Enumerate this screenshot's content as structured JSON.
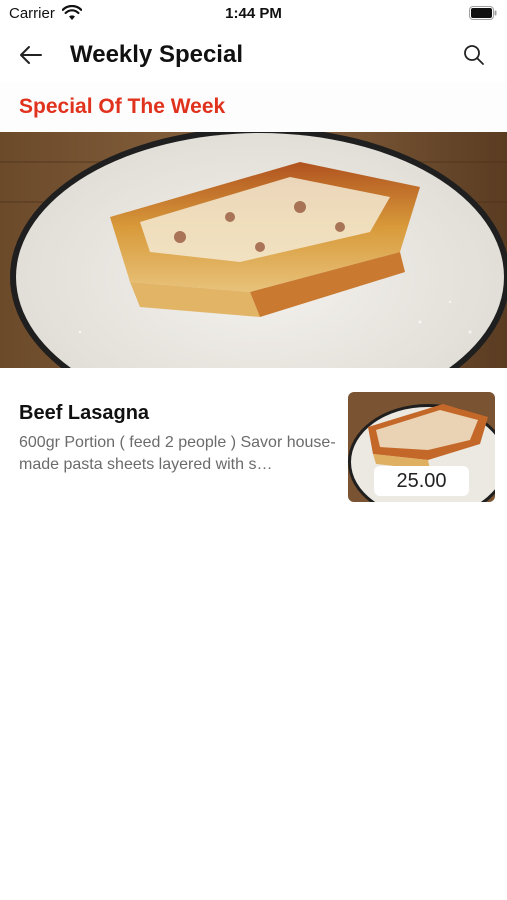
{
  "status_bar": {
    "carrier": "Carrier",
    "time": "1:44 PM",
    "icons": [
      "wifi-icon",
      "battery-icon"
    ]
  },
  "nav": {
    "title": "Weekly Special",
    "back_icon": "arrow-left-icon",
    "search_icon": "search-icon"
  },
  "section": {
    "title": "Special Of The Week",
    "accent_color": "#e0321c"
  },
  "hero": {
    "image": "lasagna-photo"
  },
  "products": [
    {
      "name": "Beef Lasagna",
      "description": "600gr Portion ( feed 2 people ) Savor house-made pasta sheets layered with s…",
      "price": "25.00",
      "image": "lasagna-thumbnail"
    }
  ]
}
